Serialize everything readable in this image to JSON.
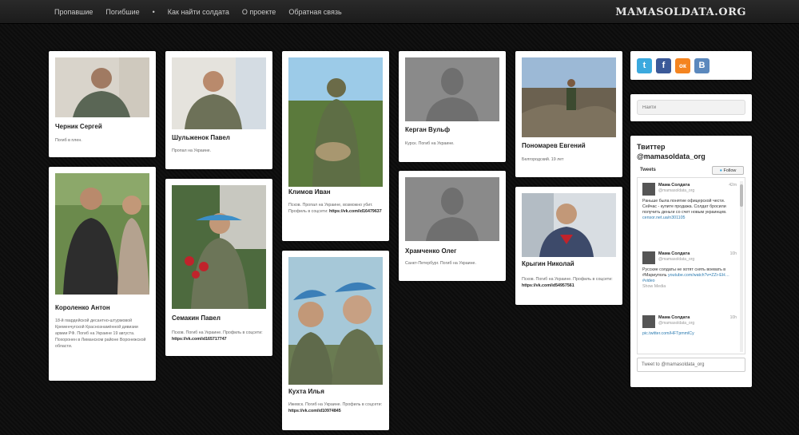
{
  "nav": {
    "items": [
      "Пропавшие",
      "Погибшие",
      "•",
      "Как найти солдата",
      "О проекте",
      "Обратная связь"
    ],
    "brand": "MAMASOLDATA.ORG"
  },
  "cards": [
    {
      "name": "Черник Сергей",
      "desc": "Погиб в плен.",
      "link": ""
    },
    {
      "name": "Короленко Антон",
      "desc": "18-й гвардейской десантно-штурмовой Кременчугской Краснознамённой дивизии армии РФ. Погиб на Украине 19 августа. Похоронен в Лиманском районе Воронежской области.",
      "link": ""
    },
    {
      "name": "Шульженок Павел",
      "desc": "Пропал на Украине.",
      "link": ""
    },
    {
      "name": "Семакин Павел",
      "desc": "Псков. Погиб на Украине. Профиль в соцсети:",
      "link": "https://vk.com/id165717747"
    },
    {
      "name": "Климов Иван",
      "desc": "Псков. Пропал на Украине, возможно убит. Профиль в соцсети:",
      "link": "https://vk.com/id16479637"
    },
    {
      "name": "Кухта Илья",
      "desc": "Ижевск. Погиб на Украине. Профиль в соцсети:",
      "link": "https://vk.com/id10974845"
    },
    {
      "name": "Керган Вульф",
      "desc": "Курск. Погиб на Украине.",
      "link": ""
    },
    {
      "name": "Храмченко Олег",
      "desc": "Санкт-Петербург. Погиб на Украине.",
      "link": ""
    },
    {
      "name": "Пономарев Евгений",
      "desc": "Белгородский. 19 лет",
      "link": ""
    },
    {
      "name": "Крыгин Николай",
      "desc": "Псков. Погиб на Украине. Профиль в соцсети:",
      "link": "https://vk.com/id54957561"
    }
  ],
  "social": {
    "icons": [
      "t",
      "f",
      "ок",
      "B"
    ],
    "colors": [
      "#3ba9de",
      "#3b5998",
      "#f48420",
      "#5b88bd"
    ]
  },
  "search": {
    "placeholder": "Найти"
  },
  "twitter": {
    "title": "Твиттер @mamasoldata_org",
    "tweets_label": "Tweets",
    "follow_label": "Follow",
    "compose": "Tweet to @mamasoldata_org",
    "tweets": [
      {
        "user": "Мама Солдата",
        "handle": "@mamasoldata_org",
        "time": "42m",
        "text": "Раньше была понятие офицерской чести. Сейчас - купите продажа. Солдат бросили получить деньги со счет новым украинцев.",
        "link": "censor.net.ua/n301105"
      },
      {
        "user": "Мама Солдата",
        "handle": "@mamasoldata_org",
        "time": "10h",
        "text": "Русские солдаты не хотят снять воевать в #Мариуполь",
        "link": "youtube.com/watch?v=ZZr-EH… #video",
        "extra": "Show Media"
      },
      {
        "user": "Мама Солдата",
        "handle": "@mamasoldata_org",
        "time": "10h",
        "text": "",
        "link": "pic.twitter.com/HFTpmmlCy"
      }
    ]
  }
}
